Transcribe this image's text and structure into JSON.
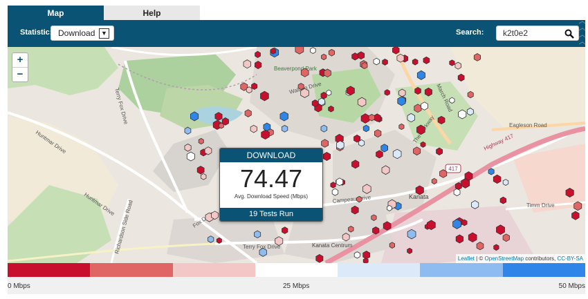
{
  "tabs": [
    {
      "label": "Map",
      "active": true
    },
    {
      "label": "Help",
      "active": false
    }
  ],
  "toolbar": {
    "statistic_label": "Statistic:",
    "statistic_value": "Download",
    "search_label": "Search:",
    "search_value": "k2t0e2"
  },
  "map": {
    "zoom_in": "+",
    "zoom_out": "−",
    "attribution": {
      "leaflet": "Leaflet",
      "sep": " | © ",
      "osm": "OpenStreetMap",
      "contrib": " contributors, ",
      "license": "CC-BY-SA"
    },
    "labels": {
      "beaverpond": "Beaverpond Park",
      "walden": "Walden Drive",
      "terry_fox": "Terry Fox Drive",
      "terry_fox_2": "Terry Fox Drive",
      "huntmar": "Huntmar Drive",
      "huntmar_2": "Huntmar Drive",
      "campeau": "Campeau Drive",
      "kanata": "Kanata",
      "kanata_centrum": "Kanata Centrum",
      "hwy417": "Highway 417",
      "hwy417_badge": "417",
      "eagleson": "Eagleson Road",
      "march": "March Road",
      "timm": "Timm Drive",
      "richardson": "Richardson Side Road",
      "parkway": "The Parkway",
      "fox": "Fox Drive"
    }
  },
  "popup": {
    "title": "DOWNLOAD",
    "value": "74.47",
    "subtitle": "Avg. Download Speed (Mbps)",
    "footer": "19 Tests Run"
  },
  "legend": {
    "colors": [
      "#c8102e",
      "#e06666",
      "#f4c7c7",
      "#ffffff",
      "#dbe9f9",
      "#8fbcf0",
      "#2f86e8"
    ],
    "min_label": "0 Mbps",
    "mid_label": "25 Mbps",
    "max_label": "50 Mbps"
  },
  "colors": {
    "brand": "#0b5375"
  }
}
